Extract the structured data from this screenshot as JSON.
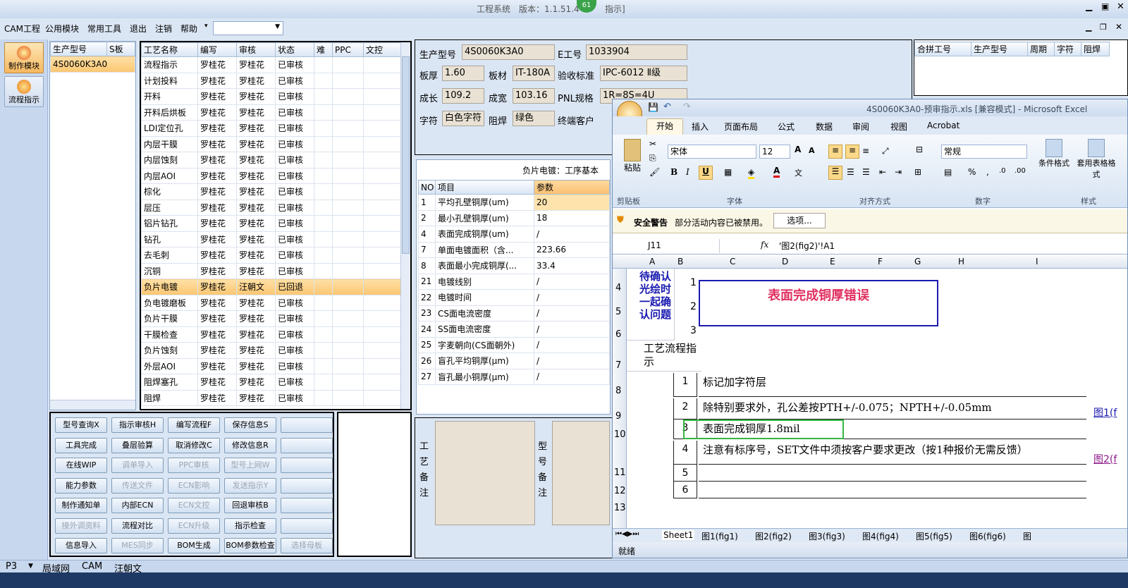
{
  "title": {
    "text": "工程系统　版本：1.1.51.4",
    "badge": "61",
    "tail": "指示]"
  },
  "menu": [
    "CAM工程",
    "公用模块",
    "常用工具",
    "退出",
    "注销",
    "帮助"
  ],
  "left_nav": [
    {
      "label": "制作模块"
    },
    {
      "label": "流程指示"
    }
  ],
  "model_list": {
    "headers": [
      "生产型号",
      "S板"
    ],
    "rows": [
      "4S0060K3A0"
    ]
  },
  "process": {
    "headers": [
      "工艺名称",
      "编写",
      "审核",
      "状态",
      "难",
      "PPC",
      "文控"
    ],
    "rows": [
      [
        "流程指示",
        "罗桂花",
        "罗桂花",
        "已审核"
      ],
      [
        "计划投料",
        "罗桂花",
        "罗桂花",
        "已审核"
      ],
      [
        "开料",
        "罗桂花",
        "罗桂花",
        "已审核"
      ],
      [
        "开料后烘板",
        "罗桂花",
        "罗桂花",
        "已审核"
      ],
      [
        "LDI定位孔",
        "罗桂花",
        "罗桂花",
        "已审核"
      ],
      [
        "内层干膜",
        "罗桂花",
        "罗桂花",
        "已审核"
      ],
      [
        "内层蚀刻",
        "罗桂花",
        "罗桂花",
        "已审核"
      ],
      [
        "内层AOI",
        "罗桂花",
        "罗桂花",
        "已审核"
      ],
      [
        "棕化",
        "罗桂花",
        "罗桂花",
        "已审核"
      ],
      [
        "层压",
        "罗桂花",
        "罗桂花",
        "已审核"
      ],
      [
        "铝片钻孔",
        "罗桂花",
        "罗桂花",
        "已审核"
      ],
      [
        "钻孔",
        "罗桂花",
        "罗桂花",
        "已审核"
      ],
      [
        "去毛刺",
        "罗桂花",
        "罗桂花",
        "已审核"
      ],
      [
        "沉铜",
        "罗桂花",
        "罗桂花",
        "已审核"
      ],
      [
        "负片电镀",
        "罗桂花",
        "汪朝文",
        "已回退"
      ],
      [
        "负电镀磨板",
        "罗桂花",
        "罗桂花",
        "已审核"
      ],
      [
        "负片干膜",
        "罗桂花",
        "罗桂花",
        "已审核"
      ],
      [
        "干膜检查",
        "罗桂花",
        "罗桂花",
        "已审核"
      ],
      [
        "负片蚀刻",
        "罗桂花",
        "罗桂花",
        "已审核"
      ],
      [
        "外层AOI",
        "罗桂花",
        "罗桂花",
        "已审核"
      ],
      [
        "阻焊塞孔",
        "罗桂花",
        "罗桂花",
        "已审核"
      ],
      [
        "阻焊",
        "罗桂花",
        "罗桂花",
        "已审核"
      ]
    ]
  },
  "buttons": [
    [
      "型号查询X",
      "指示审核H",
      "编写流程F",
      "保存信息S",
      ""
    ],
    [
      "工具完成",
      "叠层验算",
      "取消修改C",
      "修改信息R",
      ""
    ],
    [
      "在线WIP",
      "调单导入",
      "PPC审核",
      "型号上网W",
      ""
    ],
    [
      "能力参数",
      "传送文件",
      "ECN影响",
      "发送指示Y",
      ""
    ],
    [
      "制作通知单",
      "内部ECN",
      "ECN文控",
      "回退审核B",
      ""
    ],
    [
      "接外调资料",
      "流程对比",
      "ECN升级",
      "指示检查",
      ""
    ],
    [
      "信息导入",
      "MES同步",
      "BOM生成",
      "BOM参数检查",
      "选择母板"
    ]
  ],
  "info": {
    "prod_model_label": "生产型号",
    "prod_model": "4S0060K3A0",
    "e_no_label": "E工号",
    "e_no": "1033904",
    "thickness_label": "板厚",
    "thickness": "1.60",
    "material_label": "板材",
    "material": "IT-180A",
    "standard_label": "验收标准",
    "standard": "IPC-6012 Ⅱ级",
    "length_label": "成长",
    "length": "109.2",
    "width_label": "成宽",
    "width": "103.16",
    "pnl_label": "PNL规格",
    "pnl": "1R=8S=4U",
    "char_label": "字符",
    "char": "白色字符",
    "mask_label": "阻焊",
    "mask": "绿色",
    "customer_label": "终端客户"
  },
  "params": {
    "title": "负片电镀：工序基本",
    "headers": [
      "NO",
      "项目",
      "参数"
    ],
    "rows": [
      [
        "1",
        "平均孔壁铜厚(um)",
        "20"
      ],
      [
        "2",
        "最小孔壁铜厚(um)",
        "18"
      ],
      [
        "4",
        "表面完成铜厚(um)",
        "/"
      ],
      [
        "7",
        "单面电镀面积（含...",
        "223.66"
      ],
      [
        "8",
        "表面最小完成铜厚(...",
        "33.4"
      ],
      [
        "21",
        "电镀线别",
        "/"
      ],
      [
        "22",
        "电镀时间",
        "/"
      ],
      [
        "23",
        "CS面电流密度",
        "/"
      ],
      [
        "24",
        "SS面电流密度",
        "/"
      ],
      [
        "25",
        "字麦朝向(CS面朝外)",
        "/"
      ],
      [
        "26",
        "盲孔平均铜厚(μm)",
        "/"
      ],
      [
        "27",
        "盲孔最小铜厚(μm)",
        "/"
      ]
    ]
  },
  "remarks": {
    "process": "工艺备注",
    "model": "型号备注"
  },
  "merge": {
    "headers": [
      "合拼工号",
      "生产型号",
      "周期",
      "字符",
      "阻焊"
    ]
  },
  "excel": {
    "title": "4S0060K3A0-预审指示.xls [兼容模式] - Microsoft Excel",
    "tabs": [
      "开始",
      "插入",
      "页面布局",
      "公式",
      "数据",
      "审阅",
      "视图",
      "Acrobat"
    ],
    "font_name": "宋体",
    "font_size": "12",
    "number_format": "常规",
    "groups": [
      "剪贴板",
      "字体",
      "对齐方式",
      "数字",
      "样式"
    ],
    "paste": "粘贴",
    "cond_format": "条件格式",
    "table_format": "套用表格格式",
    "security_label": "安全警告",
    "security_msg": "部分活动内容已被禁用。",
    "options_btn": "选项...",
    "name_box": "J11",
    "formula": "'图2(fig2)'!A1",
    "col_headers": [
      "A",
      "B",
      "C",
      "D",
      "E",
      "F",
      "G",
      "H",
      "I"
    ],
    "row_numbers": [
      "4",
      "5",
      "6",
      "7",
      "8",
      "9",
      "10",
      "11",
      "12",
      "13"
    ],
    "confirm_text": "待确认光绘时一起确认问题",
    "red_note": "表面完成铜厚错误",
    "flow_title": "工艺流程指示",
    "steps": [
      [
        "1",
        "标记加字符层"
      ],
      [
        "2",
        "除特别要求外，孔公差按PTH+/-0.075；NPTH+/-0.05mm"
      ],
      [
        "3",
        "表面完成铜厚1.8mil"
      ],
      [
        "4",
        "注意有标序号，SET文件中须按客户要求更改（按1种报价无需反馈）"
      ],
      [
        "5",
        ""
      ],
      [
        "6",
        ""
      ]
    ],
    "link1": "图1(f",
    "link2": "图2(f",
    "sheets": [
      "Sheet1",
      "图1(fig1)",
      "图2(fig2)",
      "图3(fig3)",
      "图4(fig4)",
      "图5(fig5)",
      "图6(fig6)",
      "图"
    ],
    "status": "就绪"
  },
  "statusbar": [
    "P3",
    "局域网",
    "CAM",
    "汪朝文"
  ]
}
